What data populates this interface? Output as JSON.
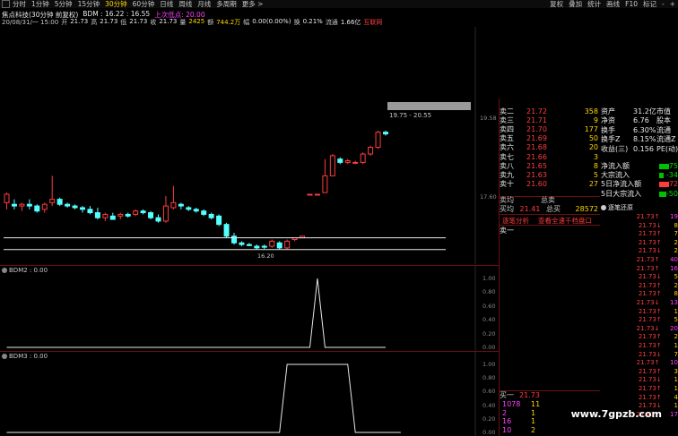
{
  "toolbar": {
    "periods": [
      "分时",
      "1分钟",
      "5分钟",
      "15分钟",
      "30分钟",
      "60分钟",
      "日线",
      "周线",
      "月线",
      "多周期",
      "更多 >"
    ],
    "active": "30分钟",
    "right_items": [
      "复权",
      "叠加",
      "统计",
      "画线",
      "F10",
      "标记",
      "-",
      "+"
    ]
  },
  "header": {
    "title": "焦点科技(30分钟 前复权)",
    "indicator": "BDM : 16.22 : 16.55",
    "indicator_note": "上次低点: 20.00",
    "bar_info": {
      "date": "20/08/31/一 15:00",
      "open_label": "开",
      "open": "21.73",
      "high_label": "高",
      "high": "21.73",
      "low_label": "低",
      "low": "21.73",
      "close_label": "收",
      "close": "21.73",
      "vol_label": "量",
      "vol": "2425",
      "amt_label": "额",
      "amt": "744.2万",
      "chg_label": "幅",
      "chg": "0.00(0.00%)",
      "turn_label": "换",
      "turn": "0.21%",
      "float_label": "流通",
      "float": "1.66亿",
      "link": "互联网"
    }
  },
  "main_chart": {
    "y_labels": [
      "19.58",
      "17.60"
    ],
    "range_text": "19.75 - 20.55",
    "low_label": "16.20"
  },
  "bdm2": {
    "label": "BDM2 : 0.00",
    "y_labels": [
      "1.00",
      "0.80",
      "0.60",
      "0.40",
      "0.20",
      "0.00"
    ]
  },
  "bdm3": {
    "label": "BDM3 : 0.00",
    "y_labels": [
      "1.00",
      "0.80",
      "0.60",
      "0.40",
      "0.20",
      "0.00"
    ]
  },
  "order_book": {
    "asks": [
      {
        "label": "卖二",
        "price": "21.72",
        "vol": "358"
      },
      {
        "label": "卖三",
        "price": "21.71",
        "vol": "9"
      },
      {
        "label": "卖四",
        "price": "21.70",
        "vol": "177"
      },
      {
        "label": "卖五",
        "price": "21.69",
        "vol": "50"
      },
      {
        "label": "卖六",
        "price": "21.68",
        "vol": "20"
      },
      {
        "label": "卖七",
        "price": "21.66",
        "vol": "3"
      },
      {
        "label": "卖八",
        "price": "21.65",
        "vol": "8"
      },
      {
        "label": "卖九",
        "price": "21.63",
        "vol": "5"
      },
      {
        "label": "卖十",
        "price": "21.60",
        "vol": "27"
      }
    ],
    "summary1": {
      "label": "卖均",
      "price": "",
      "label2": "总卖",
      "val": ""
    },
    "summary2": {
      "label": "买均",
      "price": "21.41",
      "label2": "总买",
      "val": "28572"
    },
    "btn1": "逐笔分析",
    "btn2": "查看全速千档盘口",
    "sell1_label": "卖一",
    "buy1_label": "买一",
    "buy1_price": "21.73",
    "bottom_rows": [
      {
        "a": "1078",
        "b": "11"
      },
      {
        "a": "2",
        "b": "1"
      },
      {
        "a": "16",
        "b": "1"
      },
      {
        "a": "10",
        "b": "2"
      }
    ]
  },
  "stats": {
    "rows": [
      {
        "l": "资产",
        "v": "31.2亿",
        "l2": "市值"
      },
      {
        "l": "净资",
        "v": "6.76",
        "l2": "股本"
      },
      {
        "l": "换手",
        "v": "6.30%",
        "l2": "流通"
      },
      {
        "l": "换手Z",
        "v": "8.15%",
        "l2": "流通Z"
      },
      {
        "l": "收益(三)",
        "v": "0.156",
        "l2": "PE(动)"
      }
    ],
    "flows": [
      {
        "l": "净流入额",
        "v": "-75"
      },
      {
        "l": "大宗流入",
        "v": "-34"
      },
      {
        "l": "5日净流入额",
        "v": "72"
      },
      {
        "l": "5日大宗流入",
        "v": "-50"
      }
    ]
  },
  "tick_panel": {
    "title": "逐笔还原",
    "price": "21.73",
    "vols": [
      "19",
      "8",
      "7",
      "2",
      "2",
      "40",
      "16",
      "5",
      "2",
      "8",
      "13",
      "1",
      "5",
      "20",
      "2",
      "1",
      "7",
      "10",
      "3",
      "1",
      "1",
      "4",
      "1",
      "17"
    ]
  },
  "watermark": "www.7gpzb.com",
  "chart_data": {
    "type": "candlestick",
    "title": "焦点科技(30分钟 前复权)",
    "candles": [
      {
        "o": 17.6,
        "h": 17.9,
        "l": 17.4,
        "c": 17.85
      },
      {
        "o": 17.55,
        "h": 17.7,
        "l": 17.4,
        "c": 17.5
      },
      {
        "o": 17.5,
        "h": 17.6,
        "l": 17.35,
        "c": 17.55
      },
      {
        "o": 17.55,
        "h": 17.7,
        "l": 17.4,
        "c": 17.5
      },
      {
        "o": 17.5,
        "h": 17.55,
        "l": 17.3,
        "c": 17.35
      },
      {
        "o": 17.4,
        "h": 17.6,
        "l": 17.3,
        "c": 17.55
      },
      {
        "o": 17.6,
        "h": 18.4,
        "l": 17.5,
        "c": 17.7
      },
      {
        "o": 17.7,
        "h": 17.75,
        "l": 17.5,
        "c": 17.55
      },
      {
        "o": 17.55,
        "h": 17.6,
        "l": 17.45,
        "c": 17.5
      },
      {
        "o": 17.5,
        "h": 17.55,
        "l": 17.4,
        "c": 17.45
      },
      {
        "o": 17.45,
        "h": 17.5,
        "l": 17.3,
        "c": 17.4
      },
      {
        "o": 17.4,
        "h": 17.5,
        "l": 17.25,
        "c": 17.3
      },
      {
        "o": 17.3,
        "h": 17.45,
        "l": 17.1,
        "c": 17.15
      },
      {
        "o": 17.15,
        "h": 17.3,
        "l": 17.05,
        "c": 17.25
      },
      {
        "o": 17.2,
        "h": 17.3,
        "l": 17.1,
        "c": 17.1
      },
      {
        "o": 17.2,
        "h": 17.3,
        "l": 17.1,
        "c": 17.25
      },
      {
        "o": 17.25,
        "h": 17.3,
        "l": 17.15,
        "c": 17.2
      },
      {
        "o": 17.25,
        "h": 17.4,
        "l": 17.2,
        "c": 17.35
      },
      {
        "o": 17.35,
        "h": 17.4,
        "l": 17.25,
        "c": 17.3
      },
      {
        "o": 17.3,
        "h": 17.35,
        "l": 17.1,
        "c": 17.15
      },
      {
        "o": 17.15,
        "h": 17.25,
        "l": 17.0,
        "c": 17.05
      },
      {
        "o": 17.05,
        "h": 17.8,
        "l": 17.0,
        "c": 17.5
      },
      {
        "o": 17.45,
        "h": 18.1,
        "l": 17.4,
        "c": 17.6
      },
      {
        "o": 17.55,
        "h": 17.6,
        "l": 17.4,
        "c": 17.5
      },
      {
        "o": 17.45,
        "h": 17.5,
        "l": 17.35,
        "c": 17.4
      },
      {
        "o": 17.4,
        "h": 17.45,
        "l": 17.3,
        "c": 17.35
      },
      {
        "o": 17.35,
        "h": 17.4,
        "l": 17.2,
        "c": 17.25
      },
      {
        "o": 17.25,
        "h": 17.3,
        "l": 17.1,
        "c": 17.15
      },
      {
        "o": 17.2,
        "h": 17.25,
        "l": 16.9,
        "c": 16.95
      },
      {
        "o": 16.95,
        "h": 17.0,
        "l": 16.55,
        "c": 16.6
      },
      {
        "o": 16.6,
        "h": 16.7,
        "l": 16.35,
        "c": 16.4
      },
      {
        "o": 16.4,
        "h": 16.45,
        "l": 16.3,
        "c": 16.35
      },
      {
        "o": 16.35,
        "h": 16.4,
        "l": 16.3,
        "c": 16.32
      },
      {
        "o": 16.3,
        "h": 16.35,
        "l": 16.2,
        "c": 16.25
      },
      {
        "o": 16.3,
        "h": 16.35,
        "l": 16.22,
        "c": 16.27
      },
      {
        "o": 16.3,
        "h": 16.5,
        "l": 16.25,
        "c": 16.45
      },
      {
        "o": 16.4,
        "h": 16.45,
        "l": 16.2,
        "c": 16.25
      },
      {
        "o": 16.25,
        "h": 16.5,
        "l": 16.2,
        "c": 16.45
      },
      {
        "o": 16.5,
        "h": 16.55,
        "l": 16.45,
        "c": 16.55
      },
      {
        "o": 16.55,
        "h": 16.6,
        "l": 16.55,
        "c": 16.6
      },
      {
        "o": 17.85,
        "h": 17.85,
        "l": 17.85,
        "c": 17.85
      },
      {
        "o": 17.85,
        "h": 17.85,
        "l": 17.85,
        "c": 17.85
      },
      {
        "o": 17.9,
        "h": 18.9,
        "l": 17.9,
        "c": 18.4
      },
      {
        "o": 18.4,
        "h": 19.05,
        "l": 18.4,
        "c": 19.0
      },
      {
        "o": 18.9,
        "h": 18.95,
        "l": 18.75,
        "c": 18.8
      },
      {
        "o": 18.8,
        "h": 18.9,
        "l": 18.75,
        "c": 18.85
      },
      {
        "o": 18.8,
        "h": 18.85,
        "l": 18.75,
        "c": 18.8
      },
      {
        "o": 18.8,
        "h": 19.1,
        "l": 18.75,
        "c": 19.05
      },
      {
        "o": 19.05,
        "h": 19.3,
        "l": 19.0,
        "c": 19.25
      },
      {
        "o": 19.25,
        "h": 19.75,
        "l": 19.2,
        "c": 19.7
      },
      {
        "o": 19.7,
        "h": 19.75,
        "l": 19.6,
        "c": 19.65
      }
    ],
    "hlines": [
      16.55,
      16.2
    ],
    "bdm2": [
      0,
      0,
      0,
      0,
      0,
      0,
      0,
      0,
      0,
      0,
      0,
      0,
      0,
      0,
      0,
      0,
      0,
      0,
      0,
      0,
      0,
      0,
      0,
      0,
      0,
      0,
      0,
      0,
      0,
      0,
      0,
      0,
      0,
      0,
      0,
      0,
      0,
      0,
      0,
      0,
      0,
      1,
      0,
      0,
      0,
      0,
      0,
      0,
      0,
      0,
      0
    ],
    "bdm3": [
      0,
      0,
      0,
      0,
      0,
      0,
      0,
      0,
      0,
      0,
      0,
      0,
      0,
      0,
      0,
      0,
      0,
      0,
      0,
      0,
      0,
      0,
      0,
      0,
      0,
      0,
      0,
      0,
      0,
      0,
      0,
      0,
      0,
      0,
      0,
      0,
      0,
      1,
      1,
      1,
      1,
      1,
      1,
      1,
      1,
      1,
      0,
      0,
      0,
      0,
      0,
      0,
      0
    ]
  }
}
